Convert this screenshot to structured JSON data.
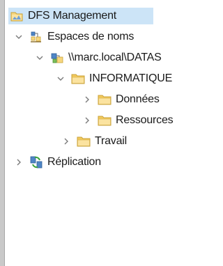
{
  "tree": {
    "root": {
      "label": "DFS Management",
      "icon": "dfs-management-icon"
    },
    "namespaces": {
      "label": "Espaces de noms",
      "icon": "namespaces-icon"
    },
    "namespace_path": {
      "label": "\\\\marc.local\\DATAS",
      "icon": "namespace-root-icon"
    },
    "informatique": {
      "label": "INFORMATIQUE",
      "icon": "folder-icon"
    },
    "donnees": {
      "label": "Données",
      "icon": "folder-icon"
    },
    "ressources": {
      "label": "Ressources",
      "icon": "folder-icon"
    },
    "travail": {
      "label": "Travail",
      "icon": "folder-icon"
    },
    "replication": {
      "label": "Réplication",
      "icon": "replication-icon"
    }
  },
  "colors": {
    "selection": "#cce4f7",
    "folder_fill": "#f7d77f",
    "folder_outline": "#c9a23a",
    "chevron": "#7a7a7a"
  }
}
